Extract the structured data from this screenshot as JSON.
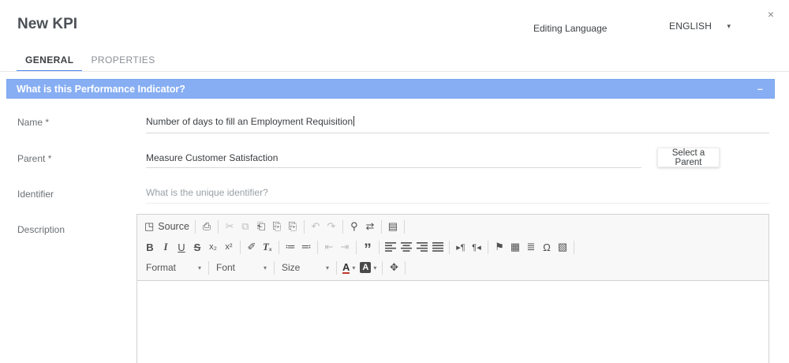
{
  "header": {
    "title": "New KPI",
    "editing_language_label": "Editing Language",
    "language_value": "ENGLISH"
  },
  "tabs": {
    "general": "GENERAL",
    "properties": "PROPERTIES"
  },
  "section": {
    "title": "What is this Performance Indicator?",
    "collapse_glyph": "–"
  },
  "fields": {
    "name": {
      "label": "Name *",
      "value": "Number of days to fill an Employment Requisition"
    },
    "parent": {
      "label": "Parent *",
      "value": "Measure Customer Satisfaction",
      "select_button": "Select a Parent"
    },
    "identifier": {
      "label": "Identifier",
      "placeholder": "What is the unique identifier?"
    },
    "description": {
      "label": "Description"
    }
  },
  "editor": {
    "source_label": "Source",
    "format_label": "Format",
    "font_label": "Font",
    "size_label": "Size"
  },
  "icons": {
    "close": "×",
    "caret_down": "▾",
    "source": "◳",
    "print": "⎙",
    "cut": "✂",
    "copy": "⧉",
    "paste": "⎗",
    "paste_plain": "⎘",
    "paste_word": "⎘",
    "undo": "↶",
    "redo": "↷",
    "find": "⚲",
    "replace": "⇄",
    "select_all": "▤",
    "bold": "B",
    "italic": "I",
    "underline": "U",
    "strike": "S",
    "subscript": "x₂",
    "superscript": "x²",
    "copy_format": "✐",
    "remove_format": "Tₓ",
    "numbered_list": "≔",
    "bullet_list": "≕",
    "outdent": "⇤",
    "indent": "⇥",
    "blockquote": "”",
    "dir_ltr": "▸¶",
    "dir_rtl": "¶◂",
    "anchor": "⚑",
    "table": "▦",
    "horizontal_rule": "≣",
    "special_char": "Ω",
    "image": "▧",
    "text_color": "A",
    "bg_color": "A",
    "maximize": "✥"
  },
  "colors": {
    "section_bg": "#87aef3",
    "tab_underline": "#4f86ec"
  }
}
